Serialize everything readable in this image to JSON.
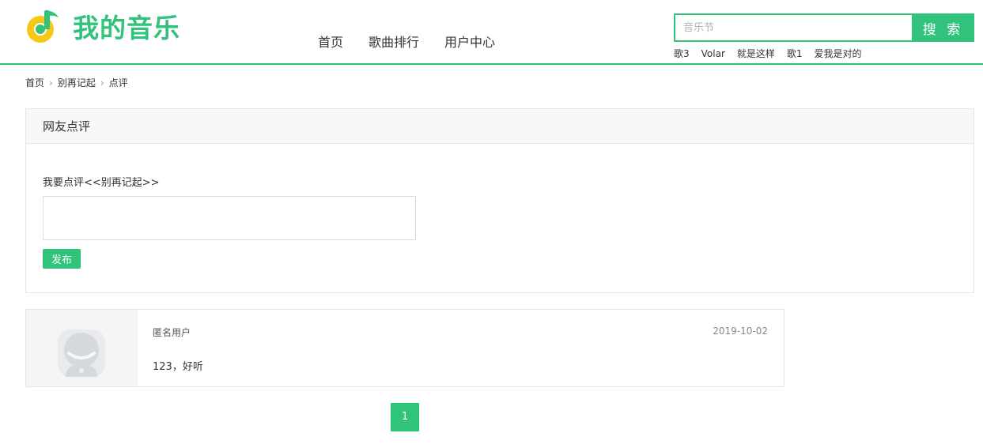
{
  "brand": {
    "name": "我的音乐",
    "color": "#31c27c",
    "icon": "music-note-logo-icon"
  },
  "nav": {
    "items": [
      "首页",
      "歌曲排行",
      "用户中心"
    ]
  },
  "search": {
    "placeholder": "音乐节",
    "value": "",
    "button_label": "搜 索"
  },
  "hot_keywords": [
    "歌3",
    "Volar",
    "就是这样",
    "歌1",
    "爱我是对的"
  ],
  "breadcrumb": {
    "items": [
      "首页",
      "别再记起",
      "点评"
    ],
    "separator": ">"
  },
  "review_panel": {
    "title": "网友点评",
    "prompt": "我要点评<<别再记起>>",
    "textarea_value": "",
    "submit_label": "发布"
  },
  "comments": [
    {
      "user": "匿名用户",
      "date": "2019-10-02",
      "text": "123，好听",
      "avatar": "default-avatar-icon"
    }
  ],
  "pagination": {
    "current": "1"
  }
}
